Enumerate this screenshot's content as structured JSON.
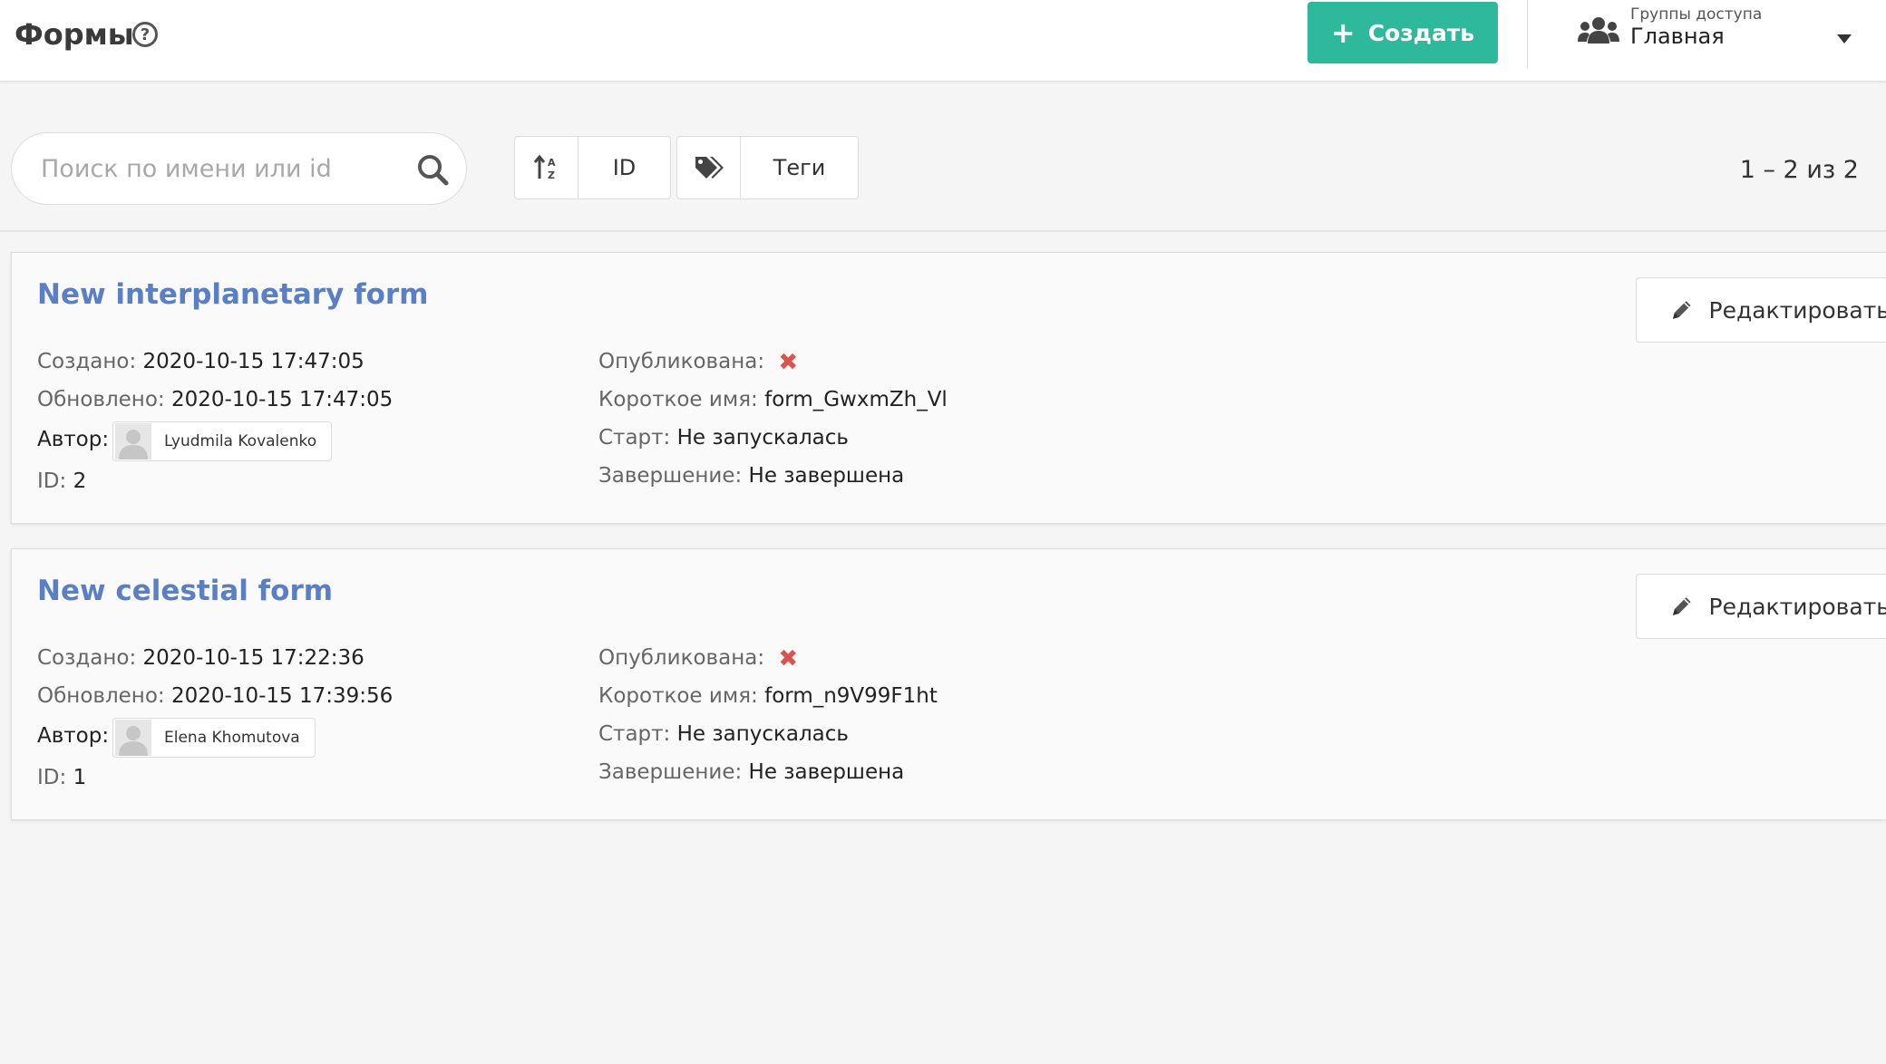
{
  "header": {
    "title": "Формы",
    "help_icon": "help-circle-icon",
    "create_label": "Создать",
    "access_group_label": "Группы доступа",
    "access_group_value": "Главная"
  },
  "toolbar": {
    "search_placeholder": "Поиск по имени или id",
    "sort_label": "ID",
    "tags_label": "Теги",
    "pagination": "1 – 2 из 2"
  },
  "labels": {
    "created": "Создано:",
    "updated": "Обновлено:",
    "author": "Автор:",
    "id": "ID:",
    "published": "Опубликована:",
    "short_name": "Короткое имя:",
    "start": "Старт:",
    "finish": "Завершение:",
    "edit": "Редактировать"
  },
  "forms": [
    {
      "title": "New interplanetary form",
      "created": "2020-10-15 17:47:05",
      "updated": "2020-10-15 17:47:05",
      "author": "Lyudmila Kovalenko",
      "id": "2",
      "published_mark": "✖",
      "short_name": "form_GwxmZh_Vl",
      "start": "Не запускалась",
      "finish": "Не завершена"
    },
    {
      "title": "New celestial form",
      "created": "2020-10-15 17:22:36",
      "updated": "2020-10-15 17:39:56",
      "author": "Elena Khomutova",
      "id": "1",
      "published_mark": "✖",
      "short_name": "form_n9V99F1ht",
      "start": "Не запускалась",
      "finish": "Не завершена"
    }
  ],
  "colors": {
    "accent": "#2fb99c",
    "link": "#5b7fc4",
    "unpublished": "#d9534f"
  }
}
